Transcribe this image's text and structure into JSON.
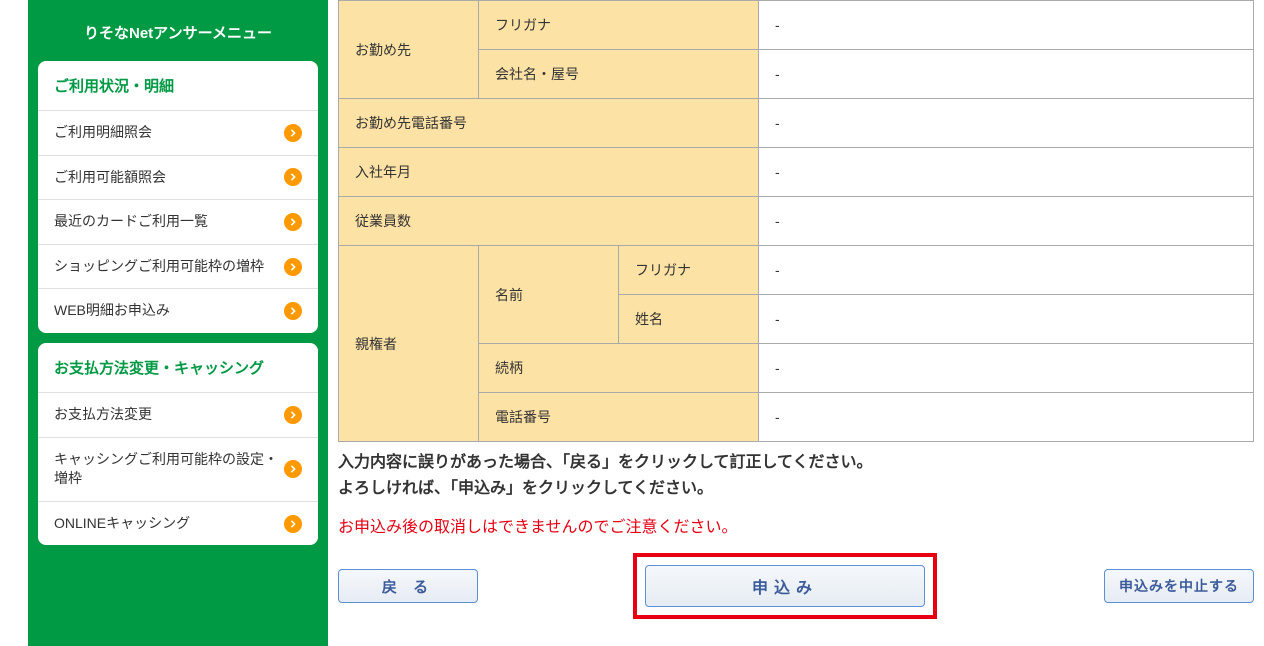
{
  "sidebar": {
    "title": "りそなNetアンサーメニュー",
    "groups": [
      {
        "title": "ご利用状況・明細",
        "items": [
          {
            "label": "ご利用明細照会"
          },
          {
            "label": "ご利用可能額照会"
          },
          {
            "label": "最近のカードご利用一覧"
          },
          {
            "label": "ショッピングご利用可能枠の増枠"
          },
          {
            "label": "WEB明細お申込み"
          }
        ]
      },
      {
        "title": "お支払方法変更・キャッシング",
        "items": [
          {
            "label": "お支払方法変更"
          },
          {
            "label": "キャッシングご利用可能枠の設定・増枠"
          },
          {
            "label": "ONLINEキャッシング"
          }
        ]
      }
    ]
  },
  "form": {
    "workplace_label": "お勤め先",
    "workplace_furigana_label": "フリガナ",
    "workplace_furigana_value": "-",
    "workplace_name_label": "会社名・屋号",
    "workplace_name_value": "-",
    "workplace_phone_label": "お勤め先電話番号",
    "workplace_phone_value": "-",
    "join_date_label": "入社年月",
    "join_date_value": "-",
    "employees_label": "従業員数",
    "employees_value": "-",
    "guardian_label": "親権者",
    "guardian_name_label": "名前",
    "guardian_furigana_label": "フリガナ",
    "guardian_furigana_value": "-",
    "guardian_name_sub_label": "姓名",
    "guardian_name_value": "-",
    "guardian_relation_label": "続柄",
    "guardian_relation_value": "-",
    "guardian_phone_label": "電話番号",
    "guardian_phone_value": "-"
  },
  "messages": {
    "instruction_line1": "入力内容に誤りがあった場合、「戻る」をクリックして訂正してください。",
    "instruction_line2": "よろしければ、「申込み」をクリックしてください。",
    "warning": "お申込み後の取消しはできませんのでご注意ください。"
  },
  "buttons": {
    "back": "戻 る",
    "apply": "申込み",
    "cancel": "申込みを中止する"
  }
}
